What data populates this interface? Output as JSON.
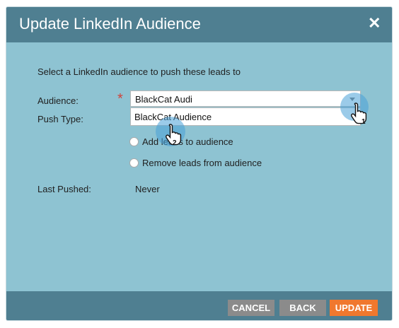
{
  "dialog": {
    "title": "Update LinkedIn Audience",
    "close_icon": "close-icon",
    "intro": "Select a LinkedIn audience to push these leads to"
  },
  "form": {
    "audience_label": "Audience:",
    "required_mark": "*",
    "audience_value": "BlackCat Audi",
    "dropdown_option": "BlackCat Audience",
    "push_type_label": "Push Type:",
    "push_options": [
      "Add leads to audience",
      "Remove leads from audience"
    ],
    "last_pushed_label": "Last Pushed:",
    "last_pushed_value": "Never"
  },
  "annotations": {
    "step1": "1",
    "step2": "2"
  },
  "footer": {
    "cancel": "CANCEL",
    "back": "BACK",
    "update": "UPDATE"
  },
  "colors": {
    "header": "#4f7f91",
    "body": "#8ec3d2",
    "accent": "#f0782e",
    "secondary_button": "#8b8b8b",
    "required": "#d0433b"
  }
}
